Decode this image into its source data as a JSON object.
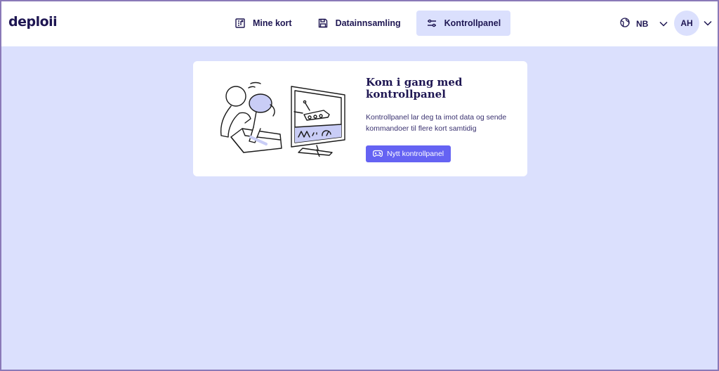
{
  "brand": {
    "logo": "deploii"
  },
  "nav": {
    "items": [
      {
        "label": "Mine kort",
        "icon": "board-icon"
      },
      {
        "label": "Datainnsamling",
        "icon": "save-icon"
      },
      {
        "label": "Kontrollpanel",
        "icon": "sliders-icon",
        "active": true
      }
    ]
  },
  "language": {
    "code": "NB",
    "icon": "globe-icon"
  },
  "user": {
    "initials": "AH"
  },
  "onboarding": {
    "title": "Kom i gang med kontrollpanel",
    "description": "Kontrollpanel lar deg ta imot data og sende kommandoer til flere kort samtidig",
    "button_label": "Nytt kontrollpanel",
    "button_icon": "gamepad-icon"
  },
  "colors": {
    "background": "#dbe0fd",
    "primary": "#6563f3",
    "text": "#1e1652"
  }
}
